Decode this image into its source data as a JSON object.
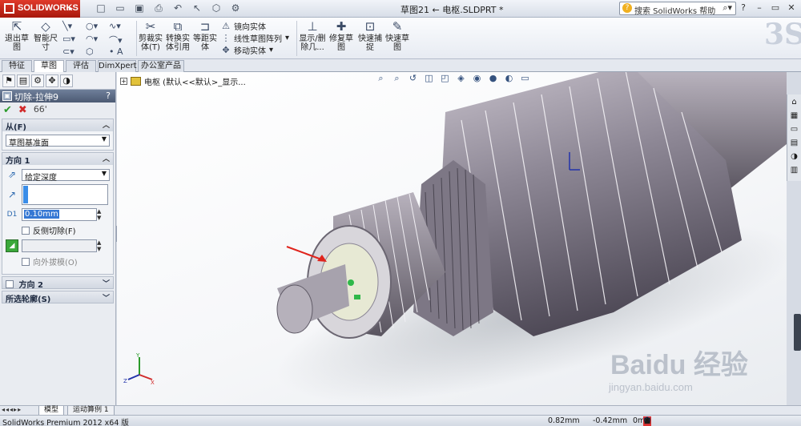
{
  "app": {
    "logo_text": "SOLIDWORKS"
  },
  "title": {
    "document": "草图21 ← 电枢.SLDPRT *"
  },
  "help_search": {
    "placeholder": "搜索 SolidWorks 帮助"
  },
  "ribbon": {
    "exit_sketch": "退出草图",
    "smart_dim": "智能尺寸",
    "trim": "剪裁实体(T)",
    "convert": "转换实体引用",
    "offset": "等距实体",
    "mirror": "镜向实体",
    "linear_pattern": "线性草图阵列",
    "move": "移动实体",
    "show_hide": "显示/删除几...",
    "repair": "修复草图",
    "snap": "快速捕捉",
    "quick_sketch": "快速草图"
  },
  "tabs": [
    "特征",
    "草图",
    "评估",
    "DimXpert",
    "办公室产品"
  ],
  "active_tab": "草图",
  "property_manager": {
    "title": "切除-拉伸9",
    "help": "?",
    "from_label": "从(F)",
    "from_value": "草图基准面",
    "dir1_label": "方向 1",
    "end_condition": "给定深度",
    "depth_value": "0.10mm",
    "flip_side": "反侧切除(F)",
    "draft_outward": "向外拔模(O)",
    "dir2_label": "方向 2",
    "selected_contours": "所选轮廓(S)",
    "depth_prefix": "D1"
  },
  "viewport": {
    "tree_item": "电枢 (默认<<默认>_显示..."
  },
  "bottom_tabs": [
    "模型",
    "运动算例 1"
  ],
  "status": {
    "product": "SolidWorks Premium 2012 x64 版",
    "x": "0.82mm",
    "y": "-0.42mm",
    "z": "0m"
  },
  "watermark": {
    "brand": "Baidu 经验",
    "url": "jingyan.baidu.com"
  },
  "colors": {
    "logo_red": "#c8271a",
    "accent_blue": "#3578d4",
    "ok_green": "#2a9a2a",
    "cancel_red": "#d12a2a",
    "model_metal": "#8d8894"
  }
}
